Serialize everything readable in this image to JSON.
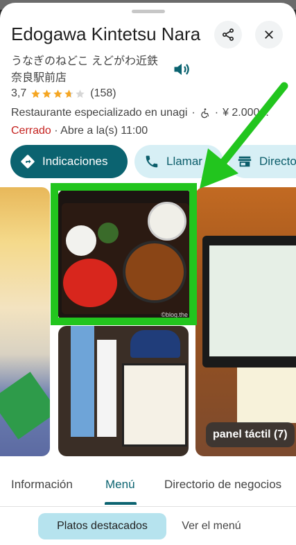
{
  "place": {
    "title": "Edogawa Kintetsu Nara",
    "native_name_line1": "うなぎのねどこ えどがわ近鉄",
    "native_name_line2": "奈良駅前店",
    "rating": "3,7",
    "rating_value": 3.7,
    "reviews": "(158)",
    "category": "Restaurante especializado en unagi",
    "separator": "·",
    "price": "¥ 2.000...",
    "status": "Cerrado",
    "hours": "· Abre a la(s) 11:00"
  },
  "actions": {
    "directions_label": "Indicaciones",
    "call_label": "Llamar",
    "directory_label": "Directo"
  },
  "photos": {
    "watermark": "©blog.the",
    "badge_label": "panel táctil (7)"
  },
  "tabs": {
    "info": "Información",
    "menu": "Menú",
    "directory": "Directorio de negocios"
  },
  "menu_subtabs": {
    "featured": "Platos destacados",
    "view_menu": "Ver el menú"
  },
  "colors": {
    "accent": "#0b6370",
    "closed": "#c5221f",
    "star": "#f5a623",
    "highlight": "#22c51e"
  },
  "icons": {
    "share": "share-icon",
    "close": "close-icon",
    "speaker": "speaker-icon",
    "directions": "directions-icon",
    "phone": "phone-icon",
    "directory": "store-icon",
    "accessible": "wheelchair-icon"
  }
}
